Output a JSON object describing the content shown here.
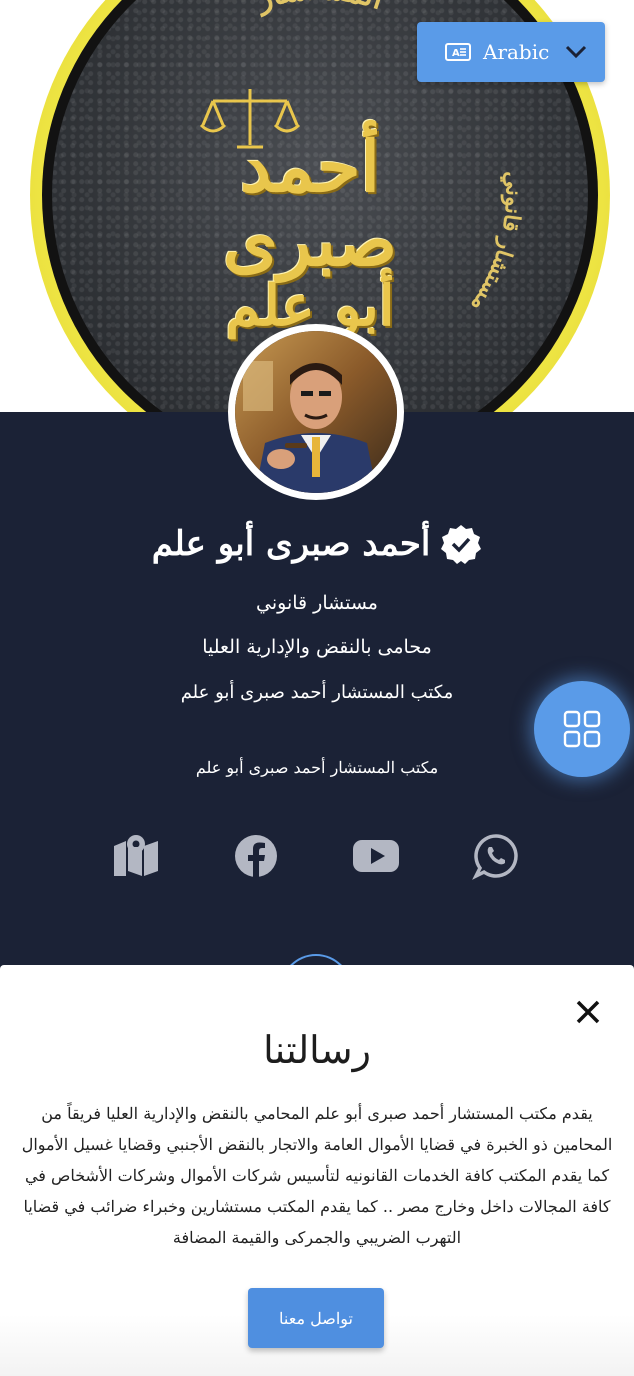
{
  "language": {
    "label": "Arabic",
    "icon": "translate-icon",
    "chevron": "chevron-down-icon"
  },
  "cover": {
    "seal_arc_top": "المستشار",
    "seal_arc_right": "مستشار قانوني",
    "seal_name_line1": "أحمد صبرى",
    "seal_name_line2": "أبو علم"
  },
  "profile": {
    "name": "أحمد صبرى أبو علم",
    "verified_icon": "verified-badge-icon",
    "title1": "مستشار قانوني",
    "title2": "محامى بالنقض والإدارية العليا",
    "title3": "مكتب المستشار أحمد صبرى أبو علم",
    "office": "مكتب المستشار أحمد صبرى أبو علم"
  },
  "social": [
    "map-icon",
    "facebook-icon",
    "youtube-icon",
    "whatsapp-icon"
  ],
  "sheet": {
    "title": "رسالتنا",
    "body": "يقدم مكتب المستشار أحمد صبرى أبو علم المحامي بالنقض والإدارية العليا فريقاً من المحامين ذو الخبرة في قضايا الأموال العامة والاتجار بالنقض الأجنبي وقضايا غسيل الأموال كما يقدم المكتب كافة الخدمات القانونيه لتأسيس شركات الأموال وشركات الأشخاص في كافة المجالات داخل وخارج مصر .. كما يقدم المكتب مستشارين وخبراء ضرائب في قضايا التهرب الضريبي والجمركى والقيمة المضافة",
    "button": "تواصل معنا"
  },
  "colors": {
    "accent": "#5a9be8",
    "background": "#1b2236",
    "gold": "#e9c64c",
    "seal_yellow": "#f3ec4a"
  }
}
